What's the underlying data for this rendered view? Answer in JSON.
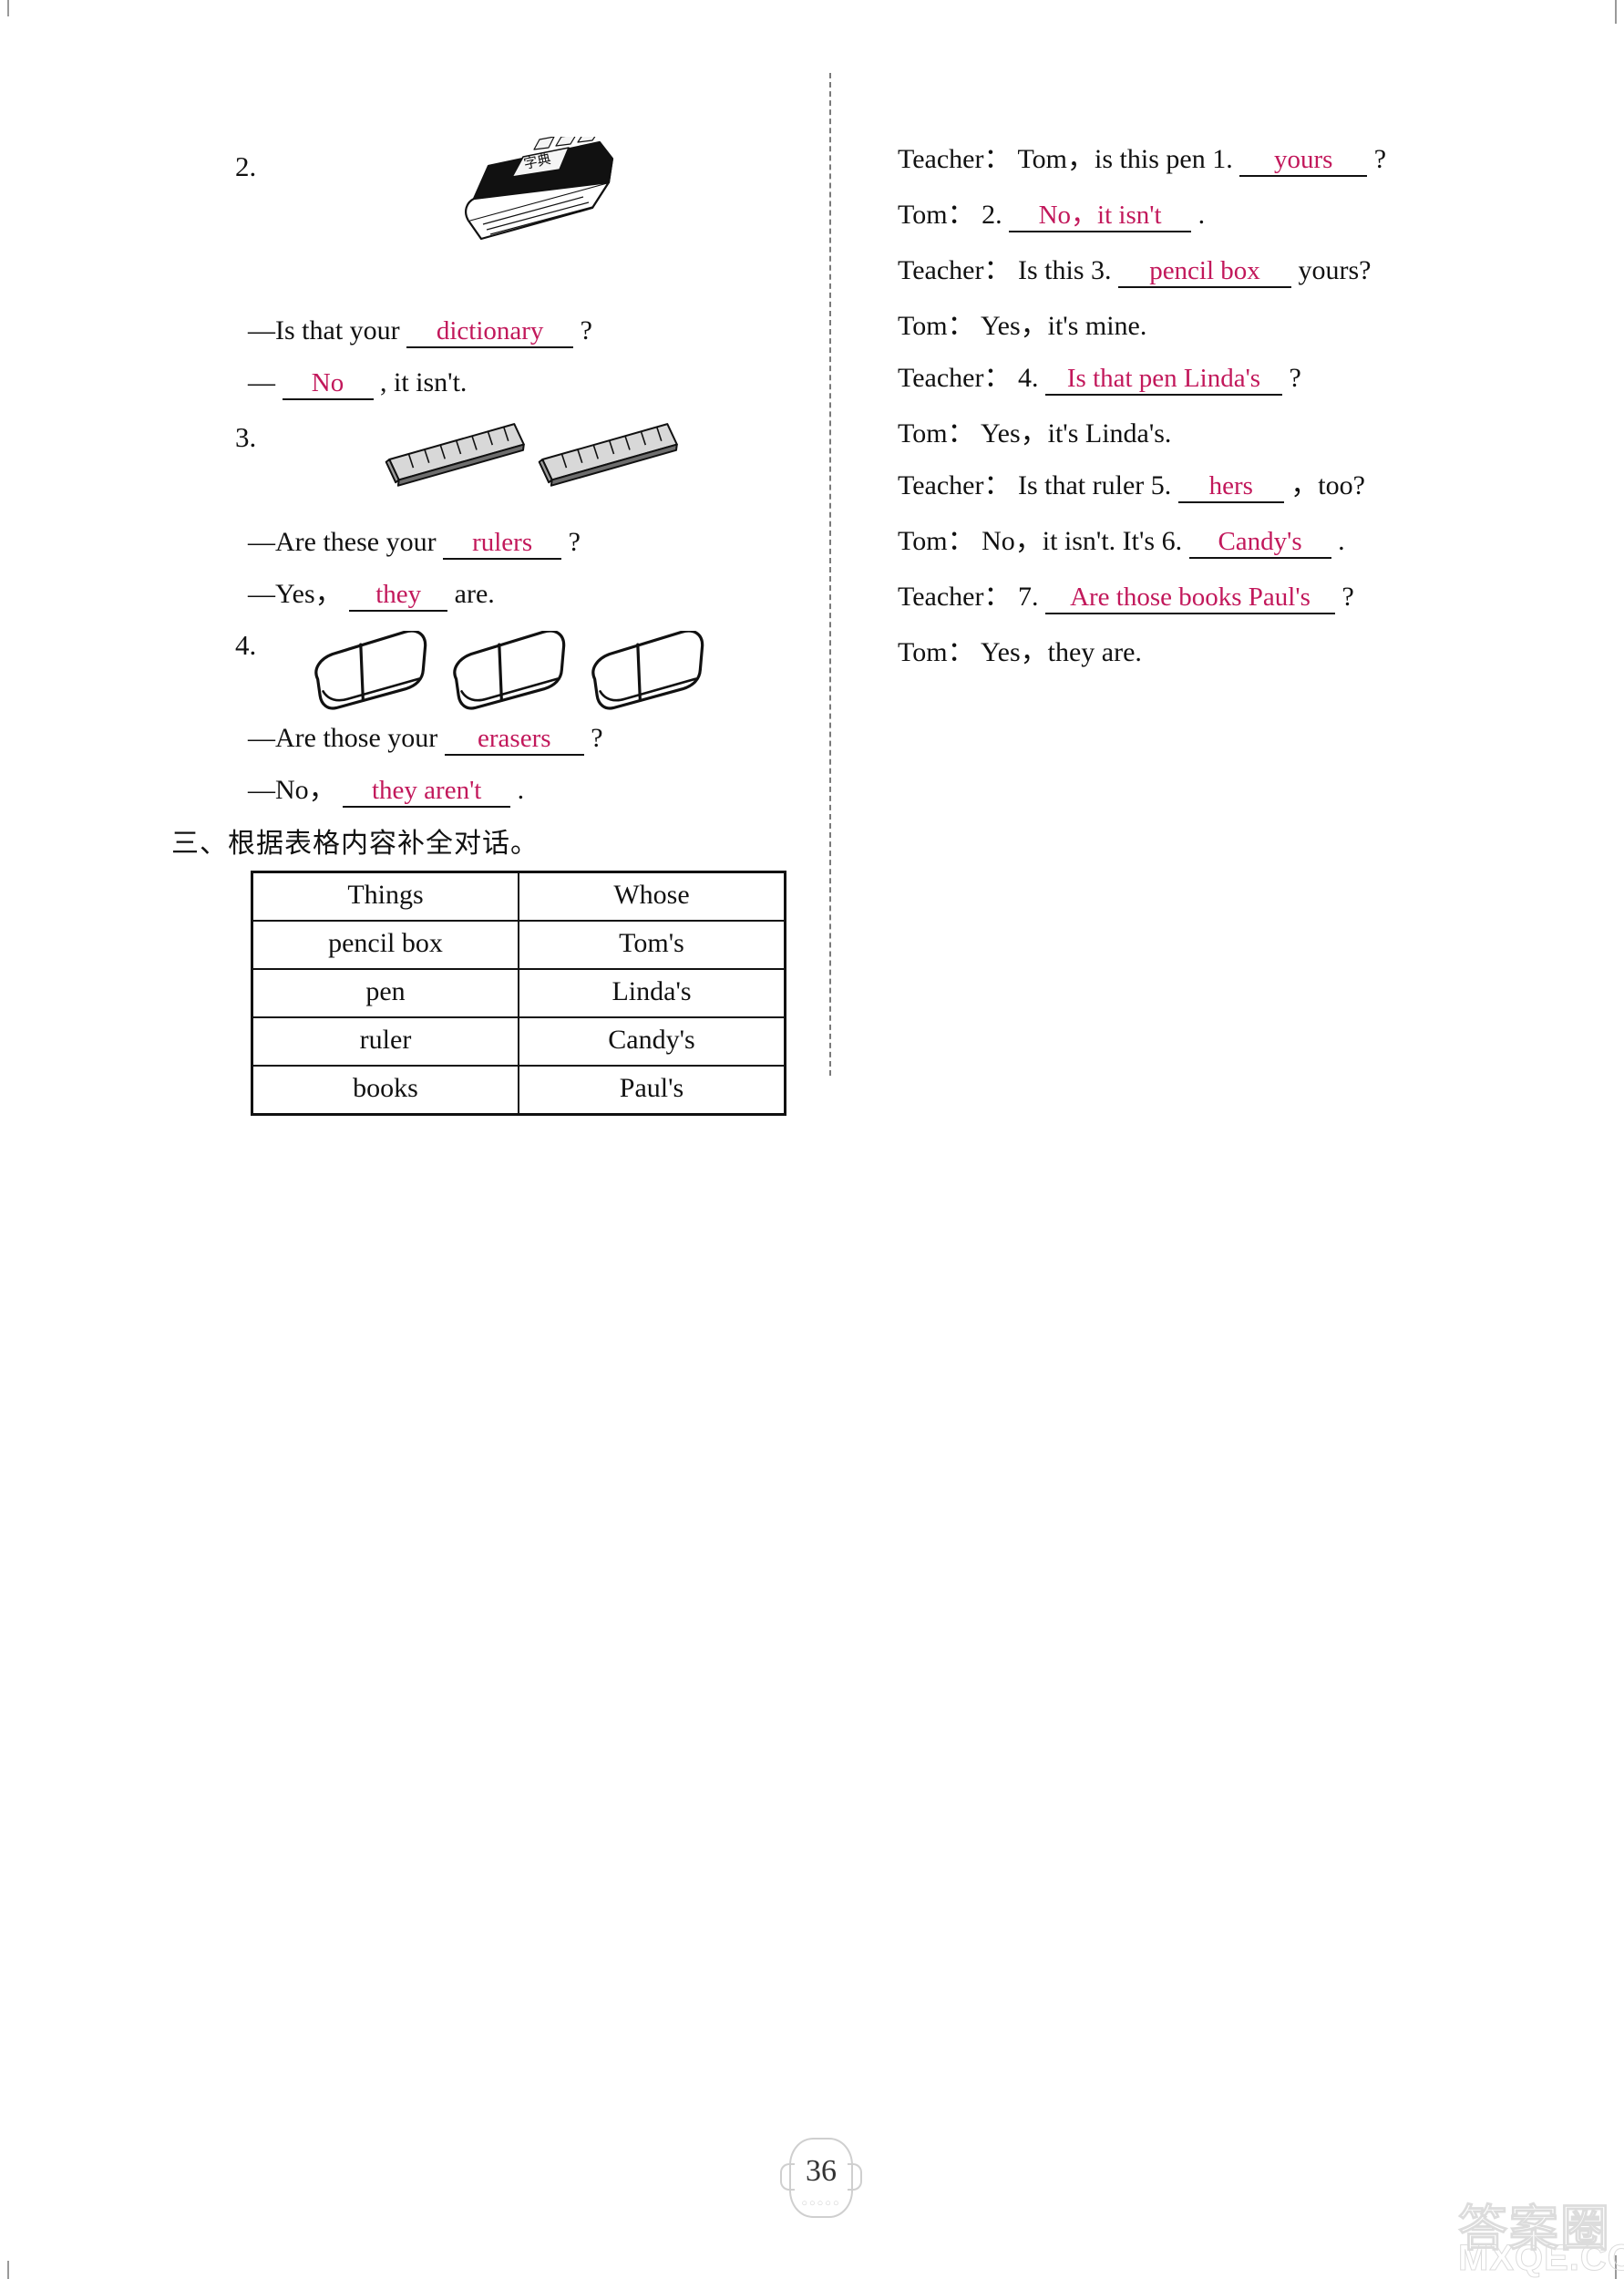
{
  "page": {
    "number": "36",
    "watermark_cn": "答案圈",
    "watermark_en": "MXQE.COM"
  },
  "left_column": {
    "items": [
      {
        "num": "2.",
        "picture": "dictionary-book",
        "question_prefix": "—Is that your",
        "answer1": "dictionary",
        "question_suffix": "?",
        "reply_prefix": "—",
        "answer2": "No",
        "reply_suffix": ", it isn't."
      },
      {
        "num": "3.",
        "picture": "two-rulers",
        "question_prefix": "—Are these your",
        "answer1": "rulers",
        "question_suffix": "?",
        "reply_prefix": "—Yes，",
        "answer2": "they",
        "reply_suffix": "are."
      },
      {
        "num": "4.",
        "picture": "three-erasers",
        "question_prefix": "—Are those your",
        "answer1": "erasers",
        "question_suffix": "?",
        "reply_prefix": "—No，",
        "answer2": "they aren't",
        "reply_suffix": "."
      }
    ],
    "section_heading": "三、根据表格内容补全对话。",
    "table": {
      "headers": [
        "Things",
        "Whose"
      ],
      "rows": [
        [
          "pencil box",
          "Tom's"
        ],
        [
          "pen",
          "Linda's"
        ],
        [
          "ruler",
          "Candy's"
        ],
        [
          "books",
          "Paul's"
        ]
      ]
    }
  },
  "right_column": {
    "dialogue": [
      {
        "speaker": "Teacher：",
        "before": "Tom，is this pen 1.",
        "blank": "yours",
        "after": "?"
      },
      {
        "speaker": "Tom：",
        "before": "2.",
        "blank": "No，it isn't",
        "after": "."
      },
      {
        "speaker": "Teacher：",
        "before": "Is this 3.",
        "blank": "pencil box",
        "after": "yours?"
      },
      {
        "speaker": "Tom：",
        "before": "Yes，it's mine.",
        "blank": "",
        "after": ""
      },
      {
        "speaker": "Teacher：",
        "before": "4.",
        "blank": "Is that pen Linda's",
        "after": "?"
      },
      {
        "speaker": "Tom：",
        "before": "Yes，it's Linda's.",
        "blank": "",
        "after": ""
      },
      {
        "speaker": "Teacher：",
        "before": "Is that ruler 5.",
        "blank": "hers",
        "after": "，too?"
      },
      {
        "speaker": "Tom：",
        "before": "No，it isn't. It's 6.",
        "blank": "Candy's",
        "after": "."
      },
      {
        "speaker": "Teacher：",
        "before": "7.",
        "blank": "Are those books Paul's",
        "after": "?"
      },
      {
        "speaker": "Tom：",
        "before": "Yes，they are.",
        "blank": "",
        "after": ""
      }
    ]
  },
  "colors": {
    "ink_answer": "#c2185b",
    "print_black": "#111111"
  }
}
